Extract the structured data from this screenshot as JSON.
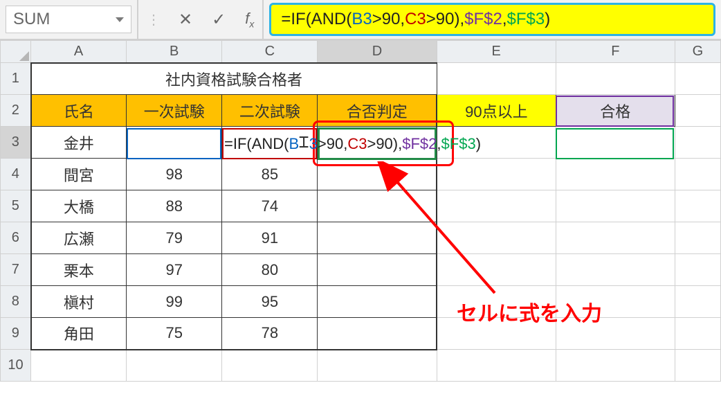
{
  "nameBox": "SUM",
  "formulaBar": {
    "p0": "=IF(AND(",
    "p1": "B3",
    "p2": ">90,",
    "p3": "C3",
    "p4": ">90),",
    "p5": "$F$2",
    "p6": ",",
    "p7": "$F$3",
    "p8": ")"
  },
  "inlineFormula": {
    "p0": "=IF(AND(",
    "p1a": "B",
    "p1b": "3",
    "p2": ">90,",
    "p3": "C3",
    "p4": ">90)",
    "p5comma": ",",
    "p5": "$F$2",
    "p6": ",",
    "p7": "$F$3",
    "p8": ")"
  },
  "columns": {
    "A": "A",
    "B": "B",
    "C": "C",
    "D": "D",
    "E": "E",
    "F": "F",
    "G": "G"
  },
  "rows": {
    "r1": "1",
    "r2": "2",
    "r3": "3",
    "r4": "4",
    "r5": "5",
    "r6": "6",
    "r7": "7",
    "r8": "8",
    "r9": "9",
    "r10": "10"
  },
  "title": "社内資格試験合格者",
  "headers": {
    "name": "氏名",
    "exam1": "一次試験",
    "exam2": "二次試験",
    "result": "合否判定",
    "threshold": "90点以上",
    "pass": "合格"
  },
  "data": {
    "r3": {
      "name": "金井",
      "e1": "",
      "e2": ""
    },
    "r4": {
      "name": "間宮",
      "e1": "98",
      "e2": "85"
    },
    "r5": {
      "name": "大橋",
      "e1": "88",
      "e2": "74"
    },
    "r6": {
      "name": "広瀬",
      "e1": "79",
      "e2": "91"
    },
    "r7": {
      "name": "栗本",
      "e1": "97",
      "e2": "80"
    },
    "r8": {
      "name": "槇村",
      "e1": "99",
      "e2": "95"
    },
    "r9": {
      "name": "角田",
      "e1": "75",
      "e2": "78"
    }
  },
  "annotation": "セルに式を入力"
}
